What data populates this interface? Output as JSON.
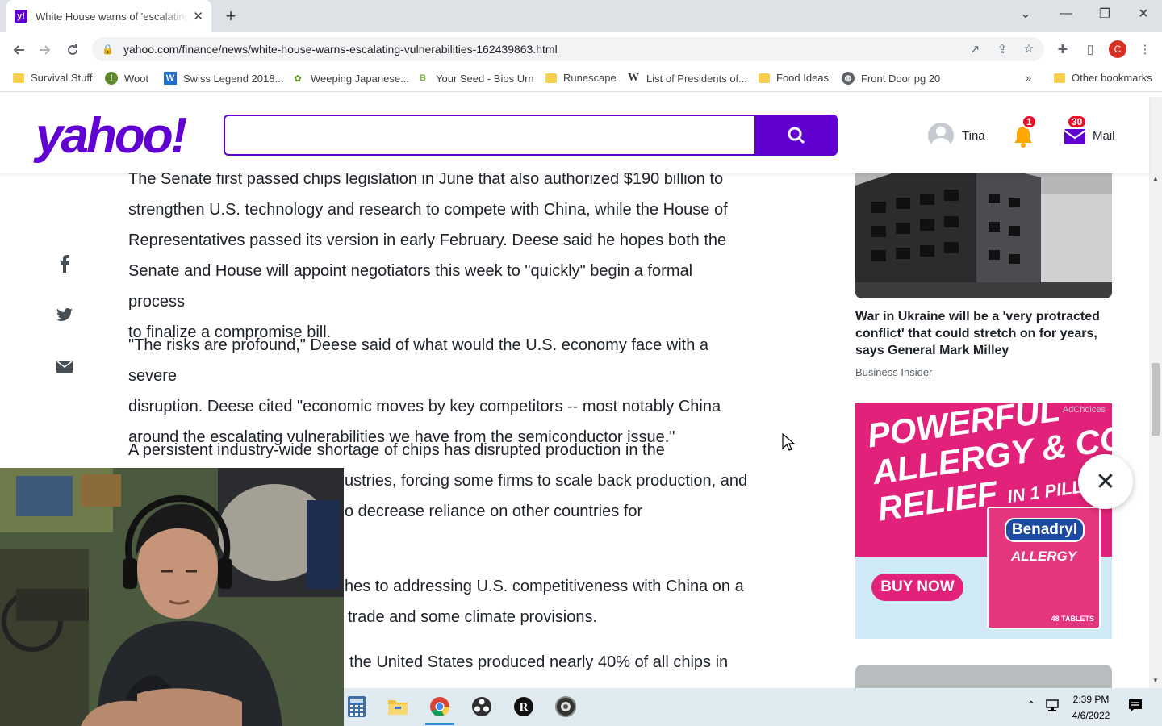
{
  "browser": {
    "tab": {
      "title": "White House warns of 'escalating vulnerabilities'",
      "favicon": "yahoo-favicon"
    },
    "address": "yahoo.com/finance/news/white-house-warns-escalating-vulnerabilities-162439863.html",
    "profile_initial": "C",
    "bookmarks": [
      {
        "label": "Survival Stuff",
        "icon": "folder-icon"
      },
      {
        "label": "Woot",
        "icon": "woot-icon"
      },
      {
        "label": "Swiss Legend 2018...",
        "icon": "w-icon"
      },
      {
        "label": "Weeping Japanese...",
        "icon": "plant-icon"
      },
      {
        "label": "Your Seed - Bios Urn",
        "icon": "b-icon"
      },
      {
        "label": "Runescape",
        "icon": "folder-icon"
      },
      {
        "label": "List of Presidents of...",
        "icon": "wikipedia-icon"
      },
      {
        "label": "Food Ideas",
        "icon": "folder-icon"
      },
      {
        "label": "Front Door pg 20",
        "icon": "globe-icon"
      }
    ],
    "overflow": "»",
    "other_bookmarks": "Other bookmarks"
  },
  "yahoo": {
    "logo": "yahoo!",
    "search_placeholder": "",
    "user_name": "Tina",
    "notification_count": "1",
    "mail_count": "30",
    "mail_label": "Mail"
  },
  "article": {
    "paragraphs": [
      {
        "lines": [
          "The Senate first passed chips legislation in June that also authorized $190 billion to",
          "strengthen U.S. technology and research to compete with China, while the House of",
          "Representatives passed its version in early February. Deese said he hopes both the",
          "Senate and House will appoint negotiators this week to \"quickly\" begin a formal process",
          "to finalize a compromise bill."
        ]
      },
      {
        "lines": [
          "\"The risks are profound,\" Deese said of what would the U.S. economy face with a severe",
          "disruption. Deese cited \"economic moves by key competitors -- most notably China",
          "around the escalating vulnerabilities we have from the semiconductor issue.\""
        ]
      },
      {
        "lines": [
          "A persistent industry-wide shortage of chips has disrupted production in the",
          "ustries, forcing some firms to scale back production, and",
          "o decrease reliance on other countries for"
        ]
      },
      {
        "lines": [
          "hes to addressing U.S. competitiveness with China on a",
          "trade and some climate provisions."
        ]
      },
      {
        "lines": [
          "the United States produced nearly 40% of all chips in"
        ]
      }
    ]
  },
  "rail": {
    "story_title": "War in Ukraine will be a 'very protracted conflict' that could stretch on for years, says General Mark Milley",
    "story_source": "Business Insider",
    "ad": {
      "choices": "AdChoices",
      "headline_1": "POWERFUL",
      "headline_2": "ALLERGY & COLD",
      "headline_3": "RELIEF",
      "headline_small": "IN 1 PILL*",
      "brand": "Benadryl",
      "sub": "ALLERGY",
      "cta": "BUY NOW",
      "count": "48 TABLETS"
    }
  },
  "taskbar": {
    "time": "2:39 PM",
    "date": "4/6/2022"
  }
}
